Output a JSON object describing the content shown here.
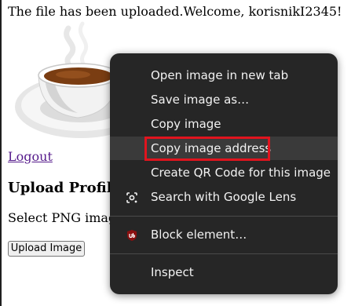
{
  "page": {
    "welcome": "The file has been uploaded.Welcome, korisnikI2345!",
    "logout": "Logout",
    "upload_heading": "Upload Profile Image",
    "select_text": "Select PNG image to upload:",
    "upload_button": "Upload Image"
  },
  "context_menu": {
    "items": [
      {
        "label": "Open image in new tab"
      },
      {
        "label": "Save image as…"
      },
      {
        "label": "Copy image"
      },
      {
        "label": "Copy image address"
      },
      {
        "label": "Create QR Code for this image"
      },
      {
        "label": "Search with Google Lens",
        "icon": "google-lens-icon"
      },
      {
        "label": "Block element…",
        "icon": "ublock-origin-icon"
      },
      {
        "label": "Inspect"
      }
    ],
    "hovered_item": "Copy image address"
  },
  "colors": {
    "menu_background": "#262626",
    "menu_hover": "#3a3a3a",
    "highlight_outline": "#e1141e",
    "link": "#551a8b"
  }
}
